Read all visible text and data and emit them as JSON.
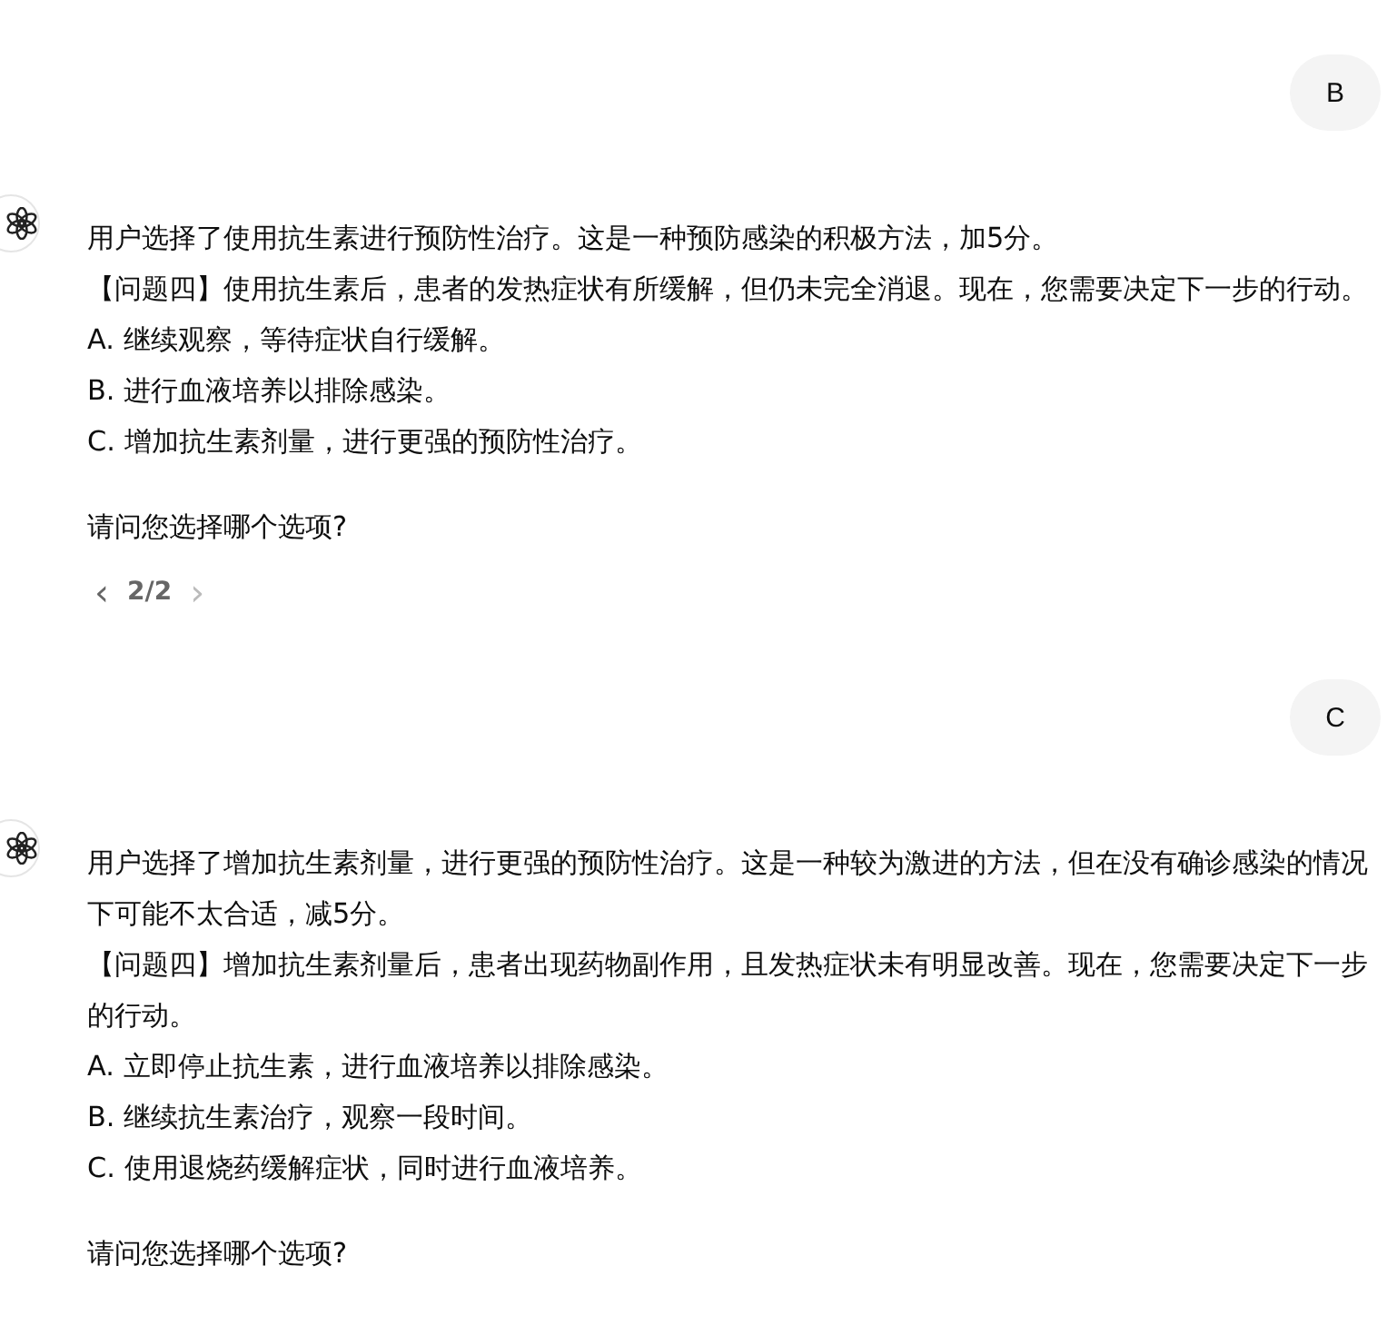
{
  "messages": [
    {
      "kind": "user",
      "text": "B"
    },
    {
      "kind": "assistant",
      "paragraphs": [
        "用户选择了使用抗生素进行预防性治疗。这是一种预防感染的积极方法，加5分。",
        "【问题四】使用抗生素后，患者的发热症状有所缓解，但仍未完全消退。现在，您需要决定下一步的行动。",
        "A. 继续观察，等待症状自行缓解。",
        "B. 进行血液培养以排除感染。",
        "C. 增加抗生素剂量，进行更强的预防性治疗。"
      ],
      "question": "请问您选择哪个选项?",
      "pager": {
        "prev": "‹",
        "label": "2/2",
        "next": "›"
      }
    },
    {
      "kind": "user",
      "text": "C"
    },
    {
      "kind": "assistant",
      "paragraphs": [
        "用户选择了增加抗生素剂量，进行更强的预防性治疗。这是一种较为激进的方法，但在没有确诊感染的情况下可能不太合适，减5分。",
        "【问题四】增加抗生素剂量后，患者出现药物副作用，且发热症状未有明显改善。现在，您需要决定下一步的行动。",
        "A. 立即停止抗生素，进行血液培养以排除感染。",
        "B. 继续抗生素治疗，观察一段时间。",
        "C. 使用退烧药缓解症状，同时进行血液培养。"
      ],
      "question": "请问您选择哪个选项?"
    }
  ]
}
